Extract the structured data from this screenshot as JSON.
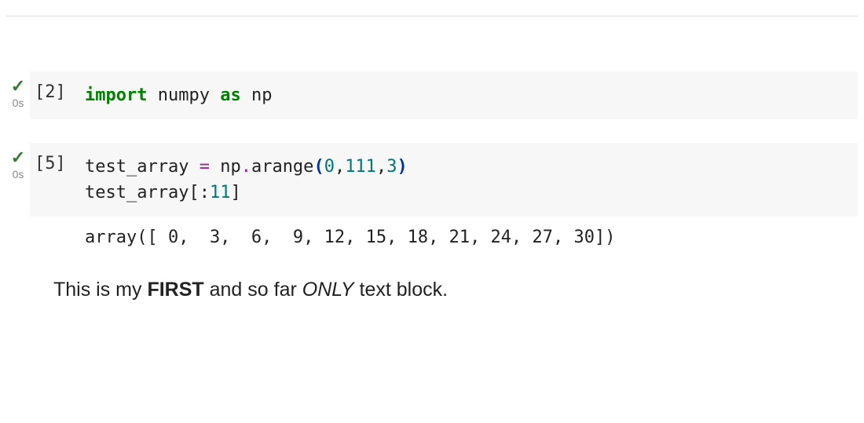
{
  "cells": [
    {
      "status": {
        "icon": "check",
        "time": "0s"
      },
      "prompt": "[2]",
      "code": {
        "tokens": [
          {
            "t": "import",
            "c": "kw"
          },
          {
            "t": " ",
            "c": ""
          },
          {
            "t": "numpy",
            "c": "name"
          },
          {
            "t": " ",
            "c": ""
          },
          {
            "t": "as",
            "c": "kw"
          },
          {
            "t": " ",
            "c": ""
          },
          {
            "t": "np",
            "c": "name"
          }
        ]
      }
    },
    {
      "status": {
        "icon": "check",
        "time": "0s"
      },
      "prompt": "[5]",
      "code": {
        "tokens": [
          {
            "t": "test_array ",
            "c": "name"
          },
          {
            "t": "=",
            "c": "op"
          },
          {
            "t": " np",
            "c": "name"
          },
          {
            "t": ".",
            "c": "op"
          },
          {
            "t": "arange",
            "c": "name"
          },
          {
            "t": "(",
            "c": "paren"
          },
          {
            "t": "0",
            "c": "num"
          },
          {
            "t": ",",
            "c": "name"
          },
          {
            "t": "111",
            "c": "num"
          },
          {
            "t": ",",
            "c": "name"
          },
          {
            "t": "3",
            "c": "num"
          },
          {
            "t": ")",
            "c": "paren"
          },
          {
            "t": "\n",
            "c": ""
          },
          {
            "t": "test_array",
            "c": "name"
          },
          {
            "t": "[:",
            "c": "name"
          },
          {
            "t": "11",
            "c": "num"
          },
          {
            "t": "]",
            "c": "name"
          }
        ]
      },
      "output": "array([ 0,  3,  6,  9, 12, 15, 18, 21, 24, 27, 30])"
    }
  ],
  "text_block": {
    "parts": [
      {
        "t": "This is my ",
        "style": ""
      },
      {
        "t": "FIRST",
        "style": "bold"
      },
      {
        "t": " and so far ",
        "style": ""
      },
      {
        "t": "ONLY",
        "style": "italic"
      },
      {
        "t": " text block.",
        "style": ""
      }
    ]
  }
}
